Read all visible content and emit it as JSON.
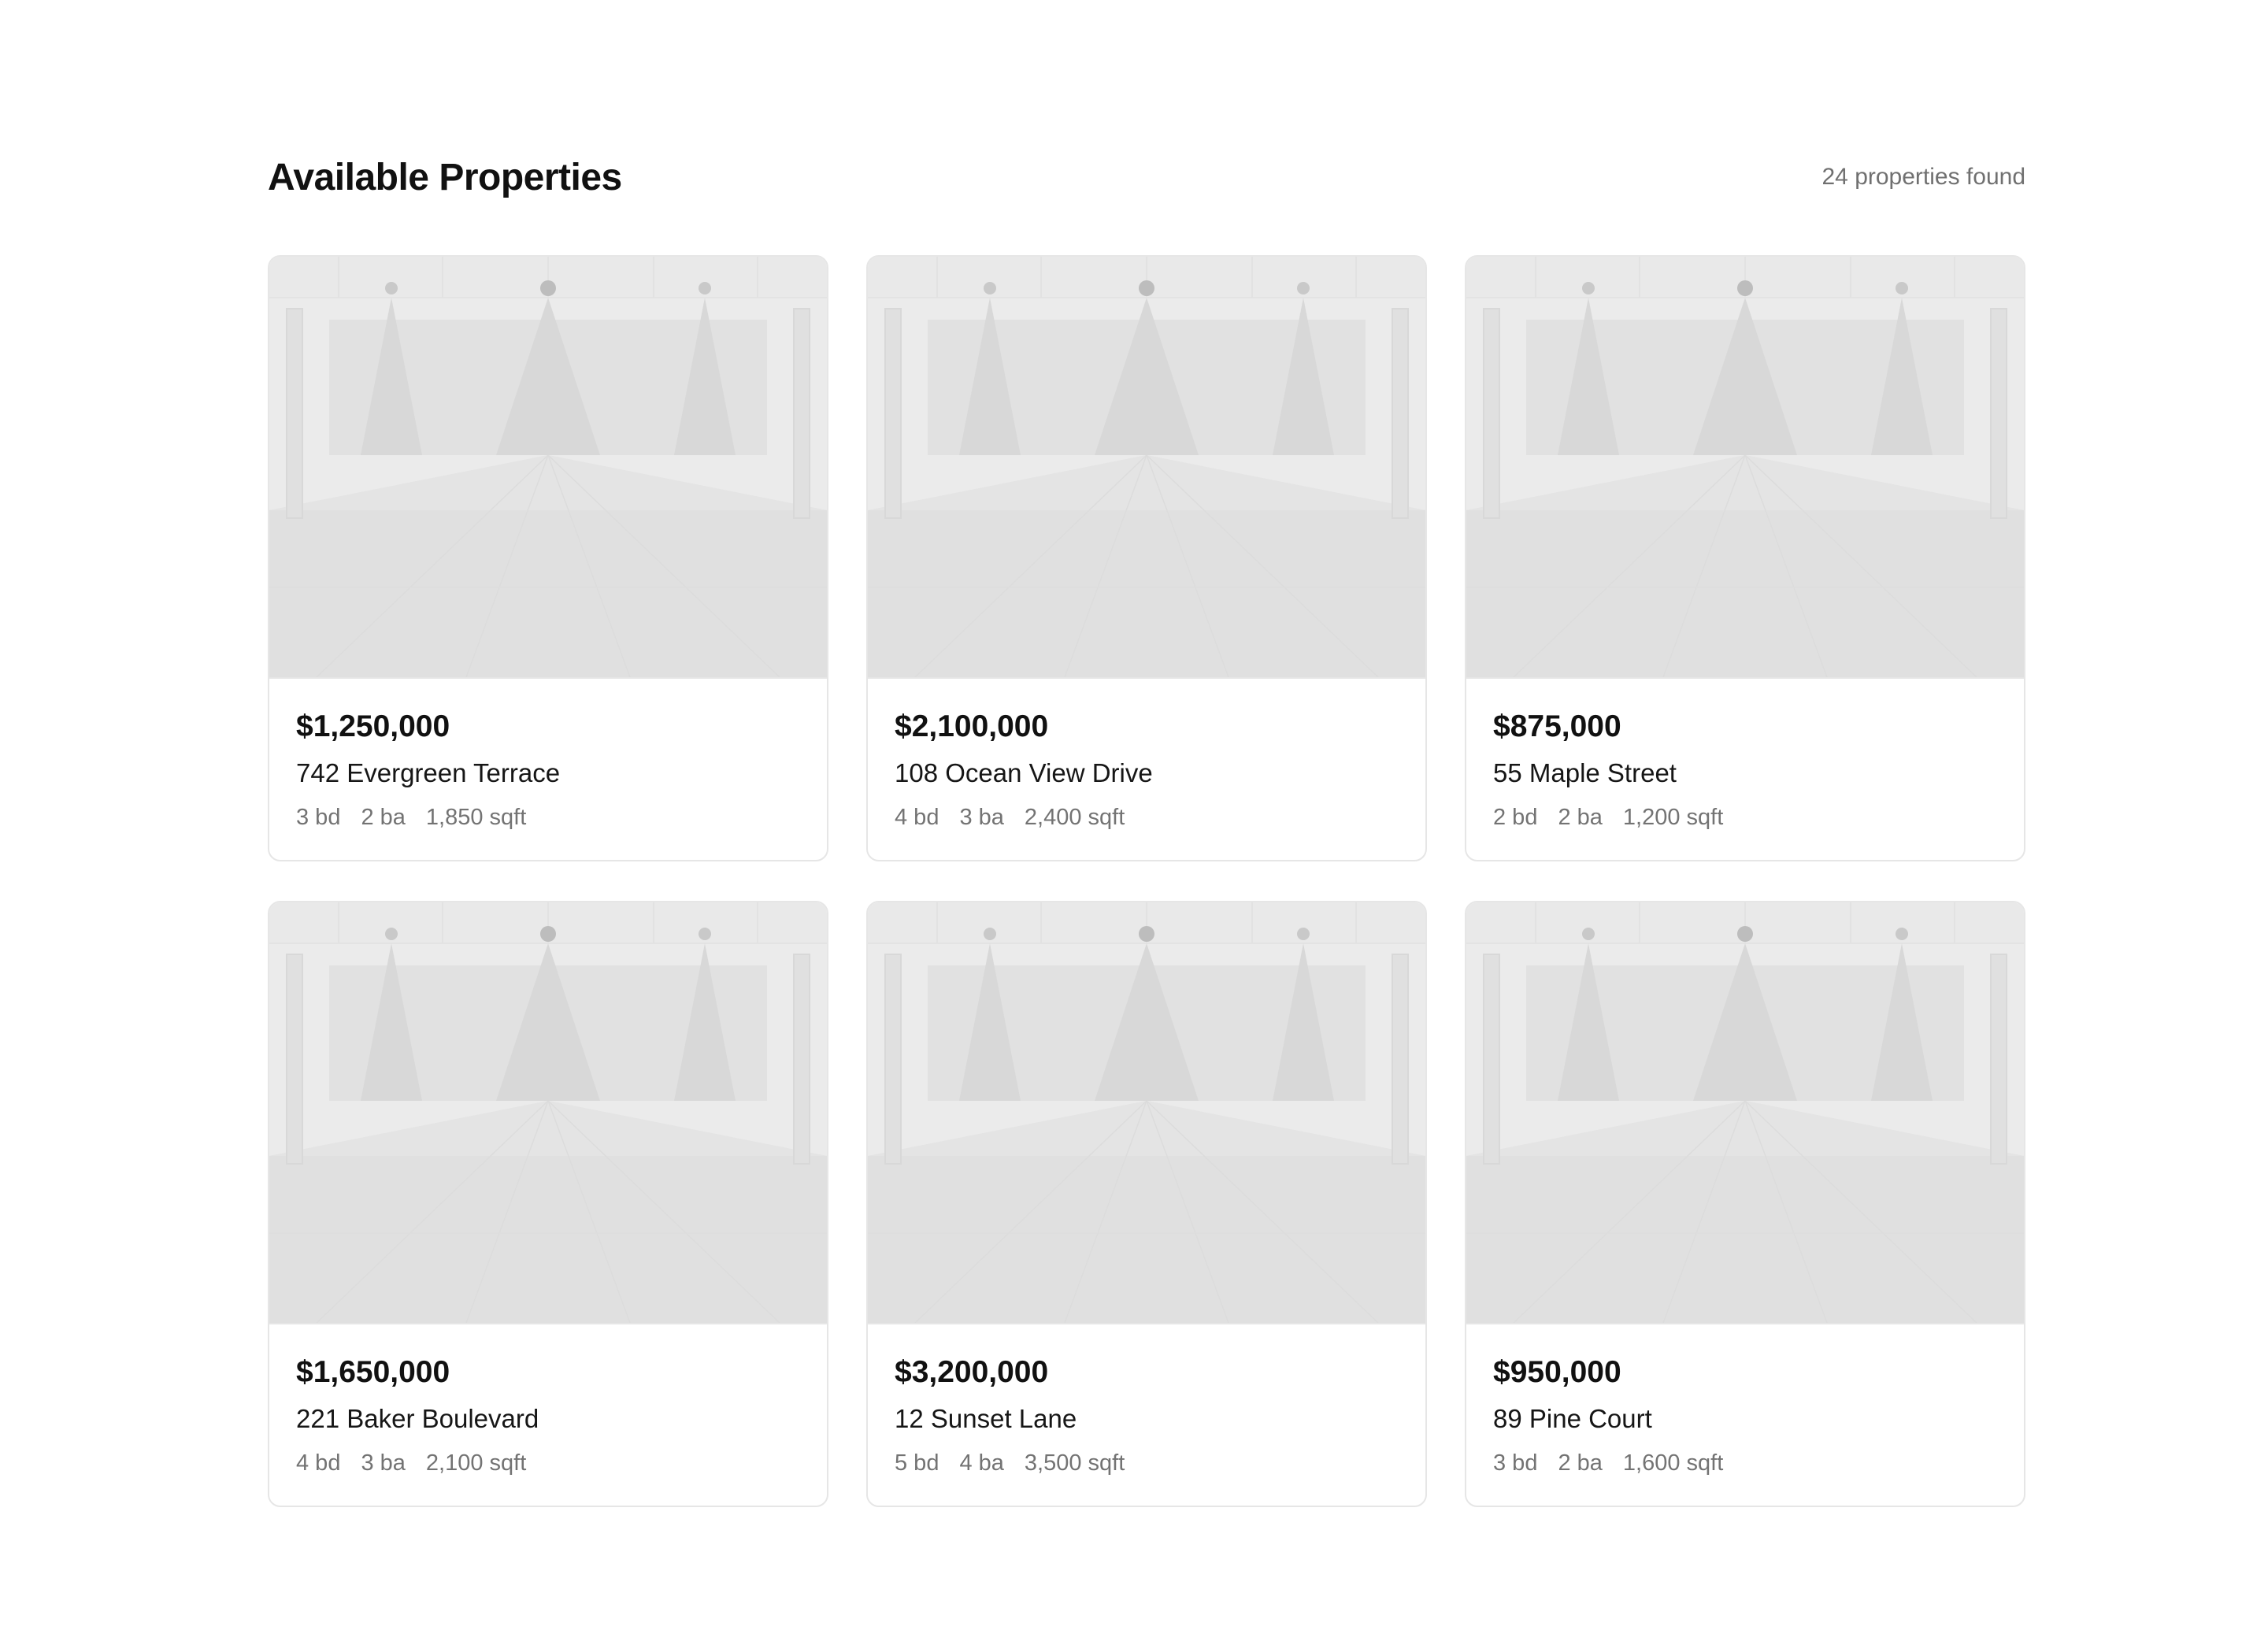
{
  "header": {
    "title": "Available Properties",
    "count_text": "24 properties found"
  },
  "listings": [
    {
      "price": "$1,250,000",
      "address": "742 Evergreen Terrace",
      "beds": "3 bd",
      "baths": "2 ba",
      "area": "1,850 sqft"
    },
    {
      "price": "$2,100,000",
      "address": "108 Ocean View Drive",
      "beds": "4 bd",
      "baths": "3 ba",
      "area": "2,400 sqft"
    },
    {
      "price": "$875,000",
      "address": "55 Maple Street",
      "beds": "2 bd",
      "baths": "2 ba",
      "area": "1,200 sqft"
    },
    {
      "price": "$1,650,000",
      "address": "221 Baker Boulevard",
      "beds": "4 bd",
      "baths": "3 ba",
      "area": "2,100 sqft"
    },
    {
      "price": "$3,200,000",
      "address": "12 Sunset Lane",
      "beds": "5 bd",
      "baths": "4 ba",
      "area": "3,500 sqft"
    },
    {
      "price": "$950,000",
      "address": "89 Pine Court",
      "beds": "3 bd",
      "baths": "2 ba",
      "area": "1,600 sqft"
    }
  ],
  "colors": {
    "card_border": "#e6e6e6",
    "muted_text": "#737373",
    "image_wall": "#ebebeb",
    "image_floor": "#e0e0e0"
  },
  "icons": {
    "listing_image": "room-placeholder-image"
  }
}
